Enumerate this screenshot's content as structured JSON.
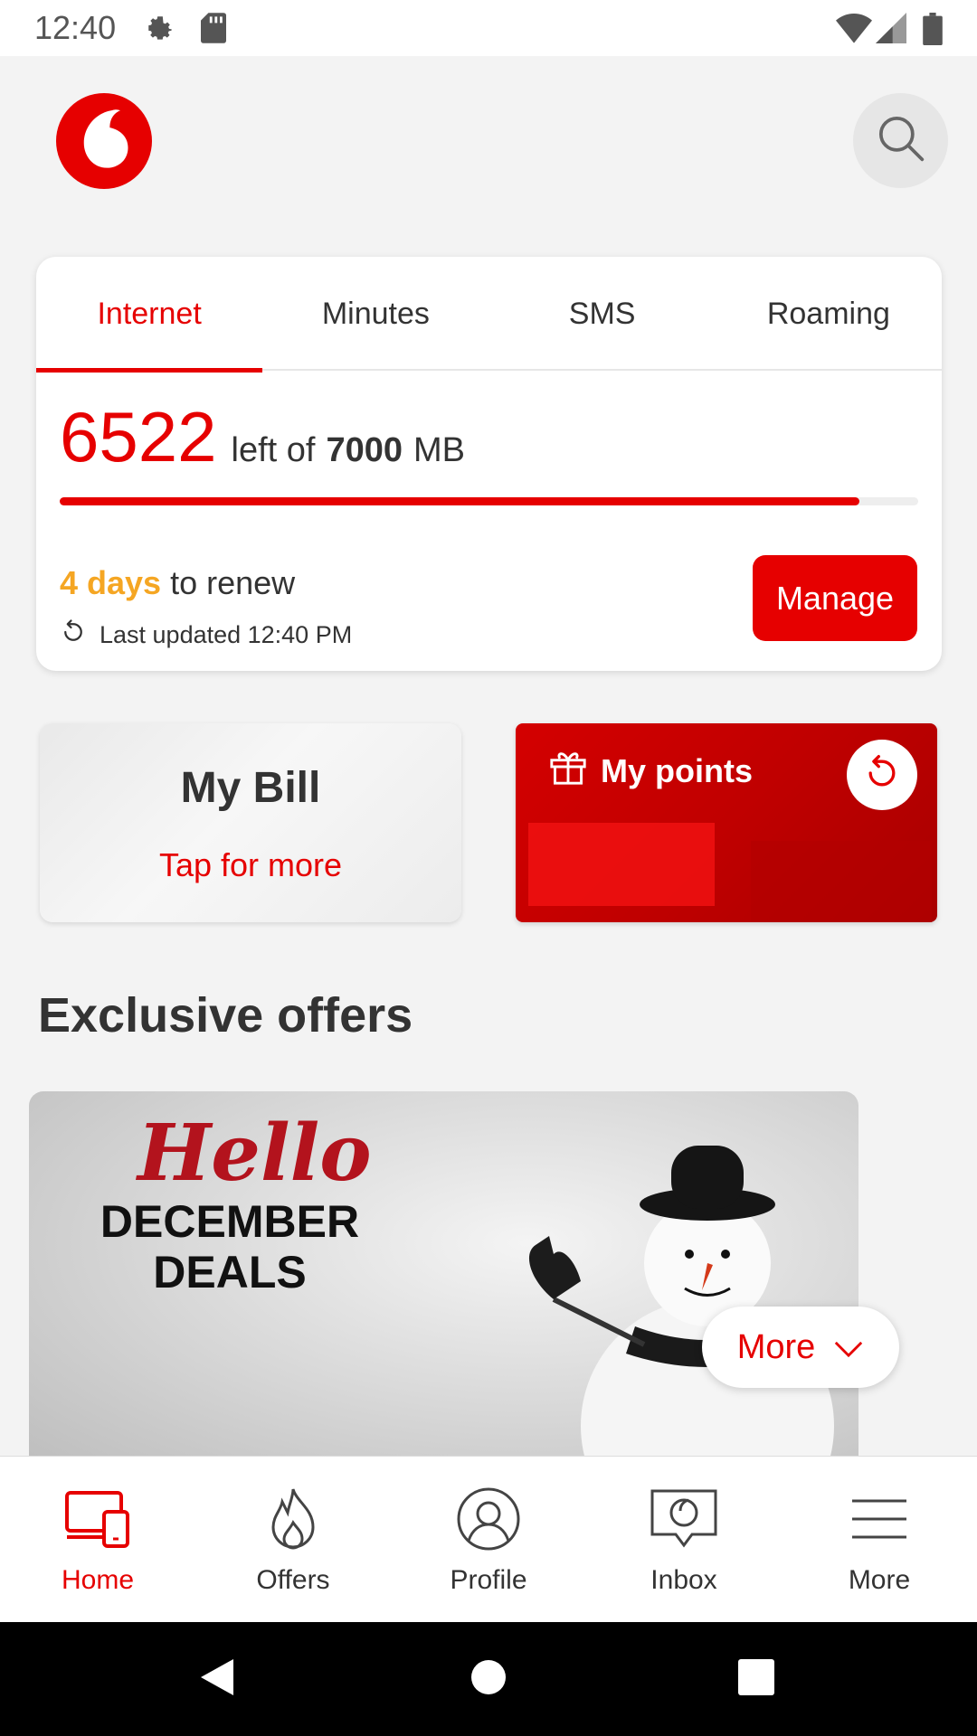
{
  "status_bar": {
    "time": "12:40"
  },
  "usage": {
    "tabs": [
      {
        "label": "Internet",
        "active": true
      },
      {
        "label": "Minutes",
        "active": false
      },
      {
        "label": "SMS",
        "active": false
      },
      {
        "label": "Roaming",
        "active": false
      }
    ],
    "remaining": "6522",
    "left_of_text": "left of",
    "total": "7000",
    "unit": "MB",
    "progress_fraction": 0.932,
    "renew_days": "4 days",
    "renew_text": "to renew",
    "last_updated": "Last updated 12:40 PM",
    "manage_label": "Manage"
  },
  "tiles": {
    "bill": {
      "title": "My Bill",
      "subtitle": "Tap for more"
    },
    "points": {
      "title": "My points"
    }
  },
  "offers": {
    "heading": "Exclusive offers",
    "banner_script": "Hello",
    "banner_title_line1": "DECEMBER",
    "banner_title_line2": "DEALS",
    "more_label": "More"
  },
  "bottom_nav": [
    {
      "label": "Home",
      "icon": "devices-icon",
      "active": true
    },
    {
      "label": "Offers",
      "icon": "flame-icon",
      "active": false
    },
    {
      "label": "Profile",
      "icon": "profile-icon",
      "active": false
    },
    {
      "label": "Inbox",
      "icon": "inbox-icon",
      "active": false
    },
    {
      "label": "More",
      "icon": "menu-icon",
      "active": false
    }
  ],
  "colors": {
    "accent": "#e60000",
    "renew": "#f5a623",
    "background": "#f3f3f3"
  }
}
